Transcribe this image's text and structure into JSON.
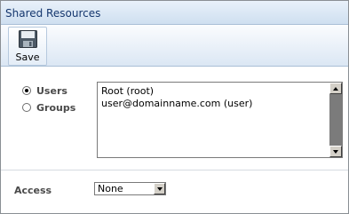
{
  "window": {
    "title": "Shared Resources"
  },
  "toolbar": {
    "save_label": "Save",
    "save_icon": "floppy-disk-icon"
  },
  "share_type": {
    "options": [
      {
        "label": "Users",
        "checked": true
      },
      {
        "label": "Groups",
        "checked": false
      }
    ]
  },
  "members": {
    "items": [
      "Root (root)",
      "user@domainname.com (user)"
    ]
  },
  "access": {
    "label": "Access",
    "value": "None"
  }
}
